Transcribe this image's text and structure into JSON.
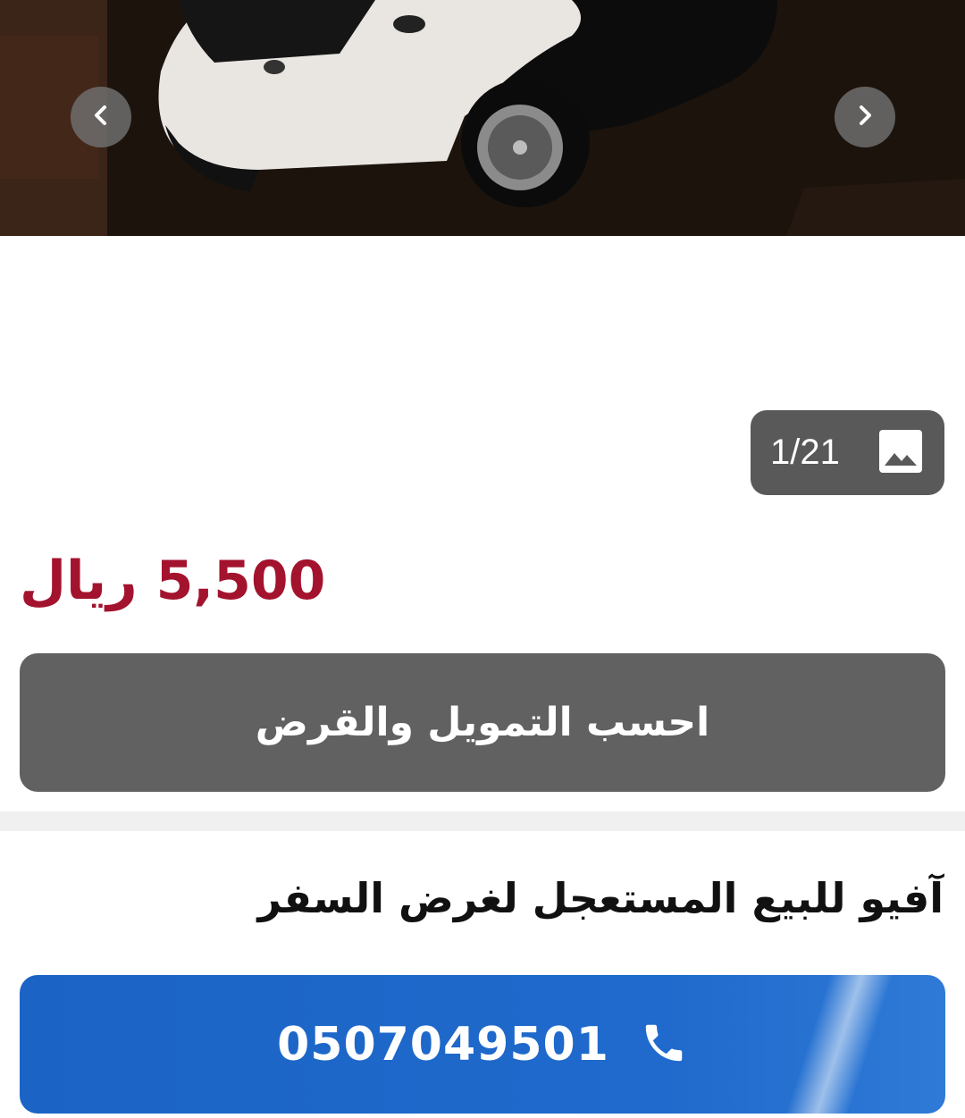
{
  "gallery": {
    "prev_icon": "chevron-left-icon",
    "next_icon": "chevron-right-icon",
    "counter": "1/21",
    "counter_icon": "image-icon"
  },
  "listing": {
    "price": "5,500 ريال",
    "finance_button": "احسب التمويل والقرض",
    "title": "آفيو للبيع المستعجل لغرض السفر",
    "phone": "0507049501",
    "phone_icon": "phone-icon"
  },
  "colors": {
    "price": "#a3132e",
    "finance_button": "#616161",
    "call_button": "#1f6acc",
    "badge": "#595959"
  }
}
